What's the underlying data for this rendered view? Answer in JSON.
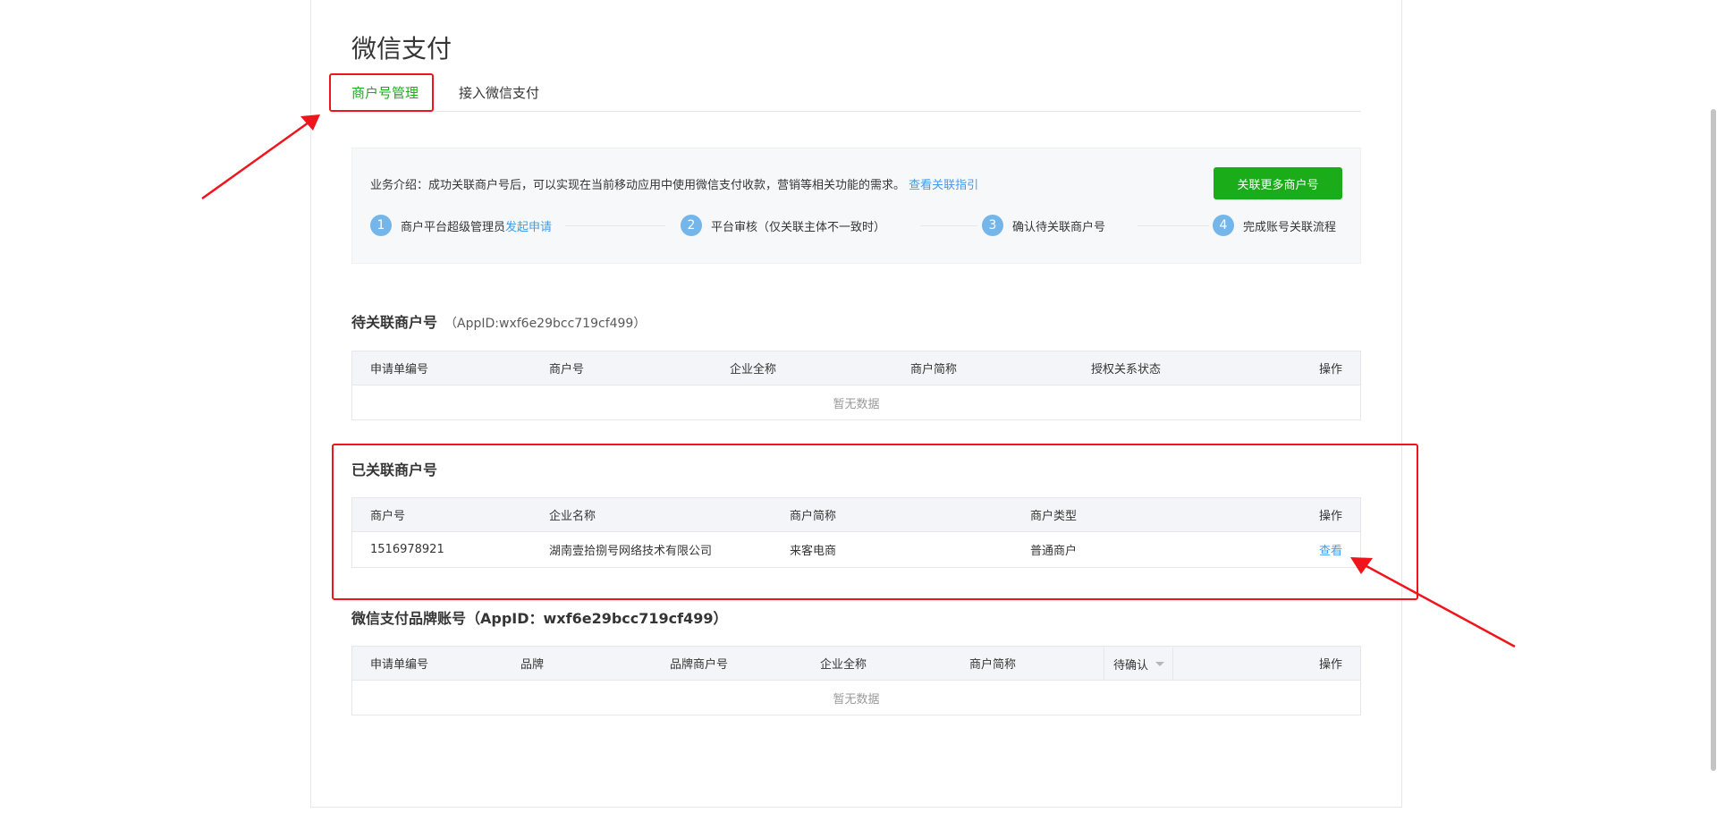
{
  "page": {
    "title": "微信支付"
  },
  "tabs": [
    {
      "label": "商户号管理",
      "active": true
    },
    {
      "label": "接入微信支付",
      "active": false
    }
  ],
  "intro": {
    "text": "业务介绍：成功关联商户号后，可以实现在当前移动应用中使用微信支付收款，营销等相关功能的需求。",
    "link": "查看关联指引",
    "button": "关联更多商户号",
    "steps": [
      {
        "num": "1",
        "text": "商户平台超级管理员",
        "link": "发起申请"
      },
      {
        "num": "2",
        "text": "平台审核（仅关联主体不一致时）"
      },
      {
        "num": "3",
        "text": "确认待关联商户号"
      },
      {
        "num": "4",
        "text": "完成账号关联流程"
      }
    ]
  },
  "pending": {
    "title": "待关联商户号",
    "appid": "（AppID:wxf6e29bcc719cf499）",
    "columns": [
      "申请单编号",
      "商户号",
      "企业全称",
      "商户简称",
      "授权关系状态",
      "操作"
    ],
    "empty": "暂无数据"
  },
  "linked": {
    "title": "已关联商户号",
    "columns": [
      "商户号",
      "企业名称",
      "商户简称",
      "商户类型",
      "操作"
    ],
    "rows": [
      {
        "merchant_id": "1516978921",
        "company": "湖南壹拾捌号网络技术有限公司",
        "short_name": "来客电商",
        "type": "普通商户",
        "action": "查看"
      }
    ]
  },
  "brand": {
    "title": "微信支付品牌账号（AppID：wxf6e29bcc719cf499）",
    "columns": [
      "申请单编号",
      "品牌",
      "品牌商户号",
      "企业全称",
      "商户简称",
      "待确认",
      "操作"
    ],
    "empty": "暂无数据"
  },
  "colors": {
    "accent_green": "#1aad19",
    "link_blue": "#459ae9",
    "annotation_red": "#f0151c",
    "step_blue": "#74b5ea"
  }
}
